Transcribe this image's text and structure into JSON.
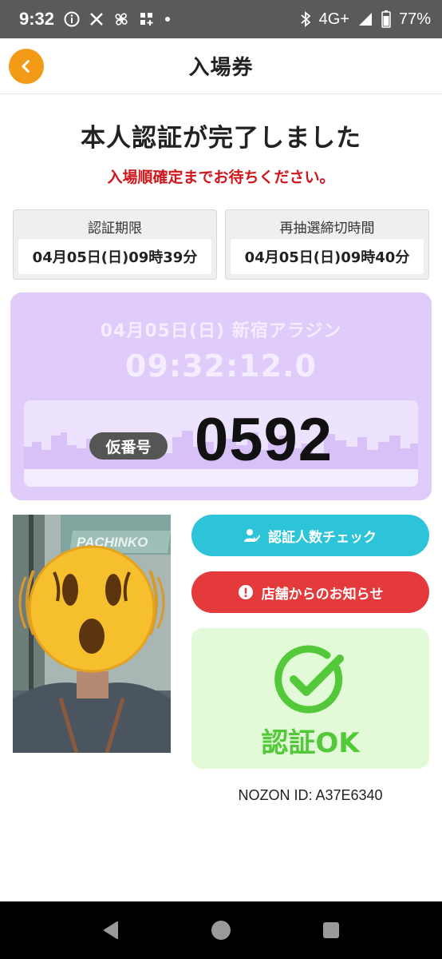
{
  "status_bar": {
    "time": "9:32",
    "network": "4G+",
    "battery": "77%",
    "icons_left": [
      "info-icon",
      "x-app-icon",
      "pinwheel-icon",
      "apps-add-icon",
      "dot-icon"
    ],
    "icons_right": [
      "bluetooth-icon",
      "signal-icon",
      "battery-icon"
    ]
  },
  "header": {
    "title": "入場券",
    "back_icon": "chevron-left-icon",
    "accent_color": "#f39a16"
  },
  "main": {
    "title": "本人認証が完了しました",
    "subtitle": "入場順確定までお待ちください。"
  },
  "info": {
    "auth_deadline": {
      "label": "認証期限",
      "value": "04月05日(日)09時39分"
    },
    "redraw_deadline": {
      "label": "再抽選締切時間",
      "value": "04月05日(日)09時40分"
    }
  },
  "ticket": {
    "date_store": "04月05日(日)  新宿アラジン",
    "clock": "09:32:12.0",
    "badge": "仮番号",
    "number": "0592",
    "bg_color": "#e0ccfa"
  },
  "photo": {
    "sign_text": "PACHINKO"
  },
  "actions": {
    "check_button": {
      "label": "認証人数チェック",
      "icon": "user-check-icon",
      "color": "#2dc3d8"
    },
    "notice_button": {
      "label": "店舗からのお知らせ",
      "icon": "alert-circle-icon",
      "color": "#e53a3c"
    }
  },
  "auth_status": {
    "label": "認証OK",
    "icon": "check-circle-icon",
    "color": "#53c93a"
  },
  "nozon_id": "NOZON ID: A37E6340",
  "navbar": {
    "icons": [
      "back-triangle-icon",
      "home-circle-icon",
      "recents-square-icon"
    ]
  }
}
